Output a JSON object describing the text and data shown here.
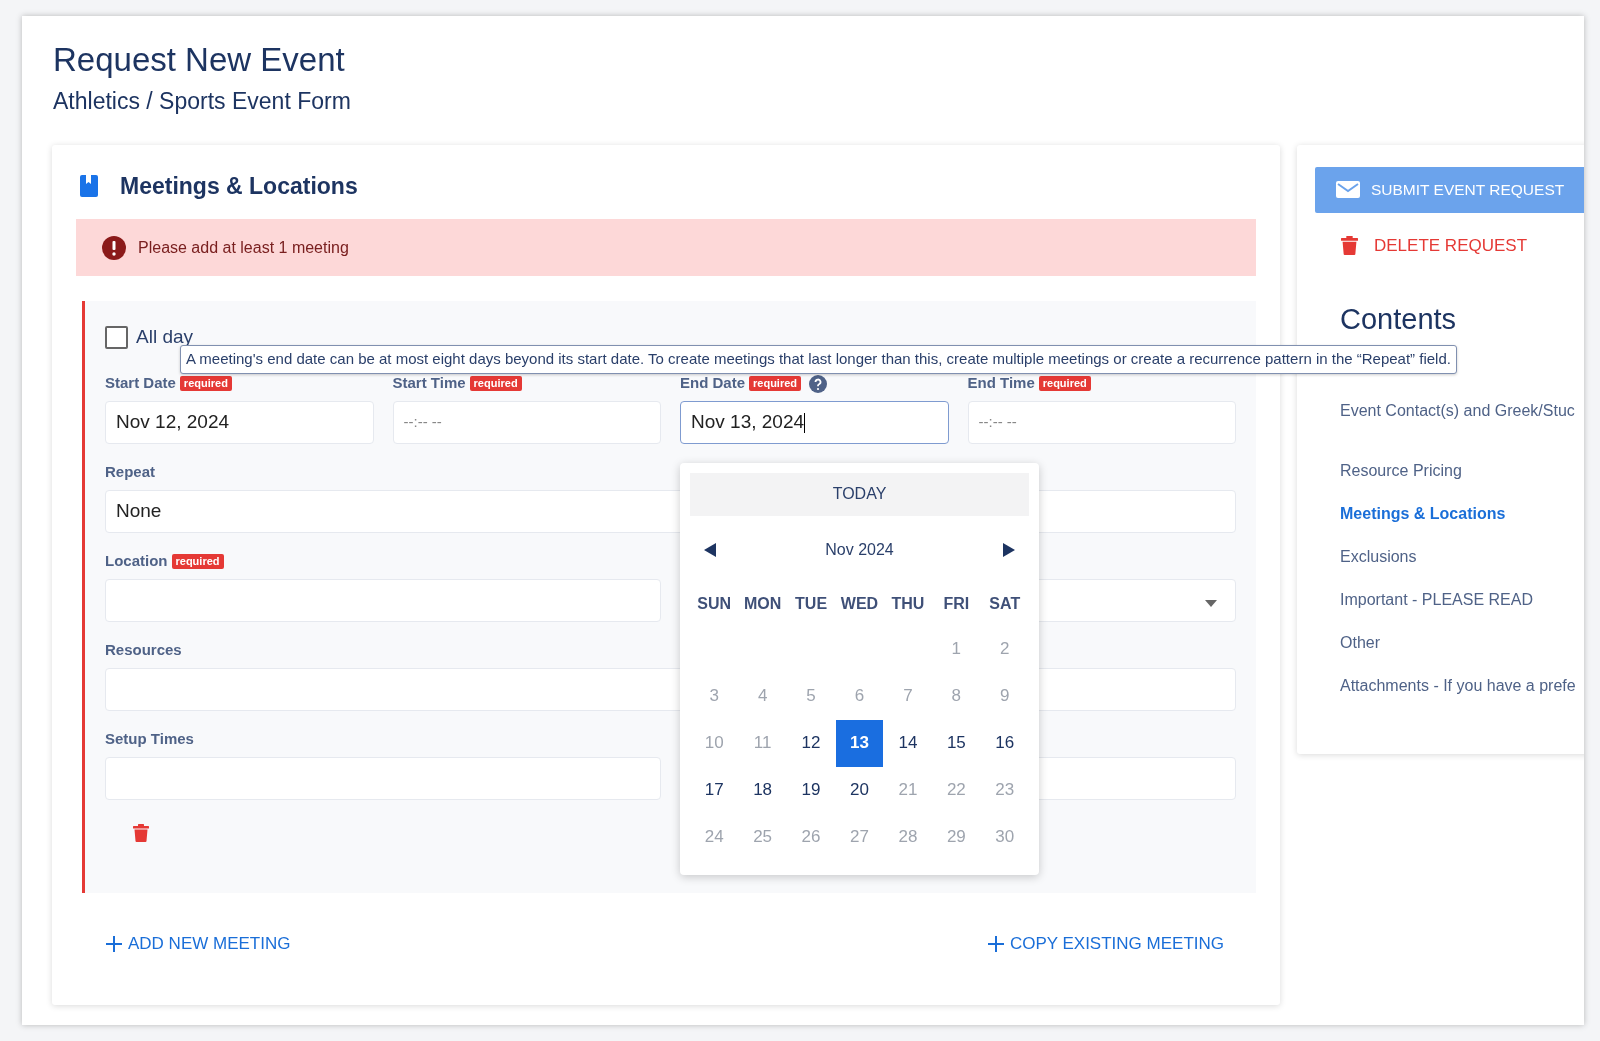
{
  "page": {
    "title": "Request New Event",
    "subtitle": "Athletics / Sports Event Form"
  },
  "section": {
    "title": "Meetings & Locations",
    "alert": "Please add at least 1 meeting"
  },
  "meeting": {
    "all_day": {
      "label": "All day",
      "checked": false
    },
    "tooltip": "A meeting's end date can be at most eight days beyond its start date. To create meetings that last longer than this, create multiple meetings or create a recurrence pattern in the “Repeat” field.",
    "rows": [
      {
        "kind": "quad",
        "fields": [
          {
            "label": "Start Date",
            "required": "required",
            "value": "Nov 12, 2024"
          },
          {
            "label": "Start Time",
            "required": "required",
            "placeholder": "--:-- --"
          },
          {
            "label": "End Date",
            "required": "required",
            "value": "Nov 13, 2024",
            "focused": true,
            "help": true
          },
          {
            "label": "End Time",
            "required": "required",
            "placeholder": "--:-- --"
          }
        ]
      },
      {
        "kind": "full",
        "fields": [
          {
            "label": "Repeat",
            "value": "None"
          }
        ]
      },
      {
        "kind": "split",
        "fields": [
          {
            "label": "Location",
            "required": "required"
          }
        ],
        "right": {
          "dropdown": true
        }
      },
      {
        "kind": "full",
        "fields": [
          {
            "label": "Resources"
          }
        ]
      },
      {
        "kind": "split",
        "fields": [
          {
            "label": "Setup Times"
          }
        ]
      }
    ]
  },
  "calendar": {
    "today": "TODAY",
    "month": "Nov 2024",
    "weekdays": [
      "SUN",
      "MON",
      "TUE",
      "WED",
      "THU",
      "FRI",
      "SAT"
    ],
    "weeks": [
      {
        "kind": "partial",
        "days": [
          {
            "day": "1",
            "enabled": false,
            "selected": false
          },
          {
            "day": "2",
            "enabled": false,
            "selected": false
          }
        ]
      },
      [
        {
          "day": "3",
          "enabled": false,
          "selected": false
        },
        {
          "day": "4",
          "enabled": false,
          "selected": false
        },
        {
          "day": "5",
          "enabled": false,
          "selected": false
        },
        {
          "day": "6",
          "enabled": false,
          "selected": false
        },
        {
          "day": "7",
          "enabled": false,
          "selected": false
        },
        {
          "day": "8",
          "enabled": false,
          "selected": false
        },
        {
          "day": "9",
          "enabled": false,
          "selected": false
        }
      ],
      [
        {
          "day": "10",
          "enabled": false,
          "selected": false
        },
        {
          "day": "11",
          "enabled": false,
          "selected": false
        },
        {
          "day": "12",
          "enabled": true,
          "selected": false
        },
        {
          "day": "13",
          "enabled": true,
          "selected": true
        },
        {
          "day": "14",
          "enabled": true,
          "selected": false
        },
        {
          "day": "15",
          "enabled": true,
          "selected": false
        },
        {
          "day": "16",
          "enabled": true,
          "selected": false
        }
      ],
      [
        {
          "day": "17",
          "enabled": true,
          "selected": false
        },
        {
          "day": "18",
          "enabled": true,
          "selected": false
        },
        {
          "day": "19",
          "enabled": true,
          "selected": false
        },
        {
          "day": "20",
          "enabled": true,
          "selected": false
        },
        {
          "day": "21",
          "enabled": false,
          "selected": false
        },
        {
          "day": "22",
          "enabled": false,
          "selected": false
        },
        {
          "day": "23",
          "enabled": false,
          "selected": false
        }
      ],
      [
        {
          "day": "24",
          "enabled": false,
          "selected": false
        },
        {
          "day": "25",
          "enabled": false,
          "selected": false
        },
        {
          "day": "26",
          "enabled": false,
          "selected": false
        },
        {
          "day": "27",
          "enabled": false,
          "selected": false
        },
        {
          "day": "28",
          "enabled": false,
          "selected": false
        },
        {
          "day": "29",
          "enabled": false,
          "selected": false
        },
        {
          "day": "30",
          "enabled": false,
          "selected": false
        }
      ]
    ]
  },
  "actions": {
    "add": "ADD NEW MEETING",
    "copy": "COPY EXISTING MEETING"
  },
  "sidebar": {
    "submit": "SUBMIT EVENT REQUEST",
    "delete": "DELETE REQUEST",
    "contents_title": "Contents",
    "items": [
      {
        "label": "Event Contact(s) and Greek/Stuc",
        "selected": false
      },
      {
        "label": "Resource Pricing",
        "selected": false
      },
      {
        "label": "Meetings & Locations",
        "selected": true
      },
      {
        "label": "Exclusions",
        "selected": false
      },
      {
        "label": "Important - PLEASE READ",
        "selected": false
      },
      {
        "label": "Other",
        "selected": false
      },
      {
        "label": "Attachments - If you have a prefe",
        "selected": false
      }
    ]
  }
}
